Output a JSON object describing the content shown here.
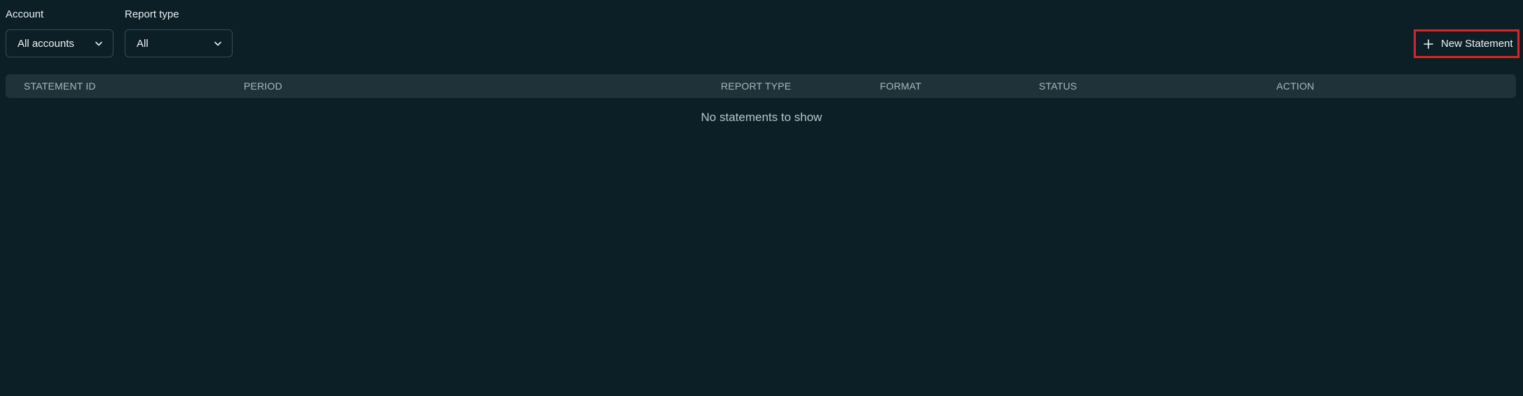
{
  "filters": {
    "account": {
      "label": "Account",
      "value": "All accounts"
    },
    "report_type": {
      "label": "Report type",
      "value": "All"
    }
  },
  "actions": {
    "new_statement_label": "New Statement"
  },
  "table": {
    "columns": [
      "STATEMENT ID",
      "PERIOD",
      "REPORT TYPE",
      "FORMAT",
      "STATUS",
      "ACTION"
    ],
    "empty_message": "No statements to show"
  },
  "colors": {
    "background": "#0c1f26",
    "header_bg": "#203239",
    "highlight_border": "#d9252a"
  },
  "icons": {
    "dropdown": "chevron-down-icon",
    "add": "plus-icon"
  }
}
